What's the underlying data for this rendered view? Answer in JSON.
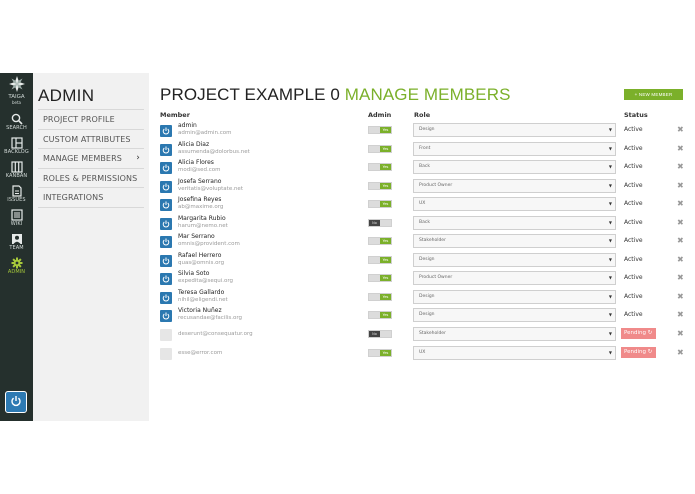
{
  "nav": {
    "logo_text": "TAIGA",
    "logo_sub": "beta",
    "items": [
      {
        "label": "SEARCH",
        "icon": "search-icon"
      },
      {
        "label": "BACKLOG",
        "icon": "backlog-icon"
      },
      {
        "label": "KANBAN",
        "icon": "kanban-icon"
      },
      {
        "label": "ISSUES",
        "icon": "issues-icon"
      },
      {
        "label": "WIKI",
        "icon": "wiki-icon"
      },
      {
        "label": "TEAM",
        "icon": "team-icon"
      },
      {
        "label": "ADMIN",
        "icon": "gear-icon"
      }
    ],
    "active_color": "#a7c93b"
  },
  "sidebar": {
    "title": "ADMIN",
    "items": [
      {
        "label": "PROJECT PROFILE"
      },
      {
        "label": "CUSTOM ATTRIBUTES"
      },
      {
        "label": "MANAGE MEMBERS",
        "chevron": "›"
      },
      {
        "label": "ROLES & PERMISSIONS"
      },
      {
        "label": "INTEGRATIONS"
      }
    ]
  },
  "header": {
    "project": "PROJECT EXAMPLE 0",
    "section": "MANAGE MEMBERS",
    "new_member_label": "+ NEW MEMBER",
    "accent": "#7bb02a"
  },
  "table": {
    "headers": {
      "member": "Member",
      "admin": "Admin",
      "role": "Role",
      "status": "Status"
    },
    "delete_glyph": "✖",
    "select_arrow": "▼",
    "rows": [
      {
        "name": "admin",
        "email": "admin@admin.com",
        "admin": "Yes",
        "role": "Design",
        "status": "Active"
      },
      {
        "name": "Alicia Diaz",
        "email": "assumenda@dolorbus.net",
        "admin": "Yes",
        "role": "Front",
        "status": "Active"
      },
      {
        "name": "Alicia Flores",
        "email": "modi@sed.com",
        "admin": "Yes",
        "role": "Back",
        "status": "Active"
      },
      {
        "name": "Josefa Serrano",
        "email": "veritatis@voluptate.net",
        "admin": "Yes",
        "role": "Product Owner",
        "status": "Active"
      },
      {
        "name": "Josefina Reyes",
        "email": "ab@maxime.org",
        "admin": "Yes",
        "role": "UX",
        "status": "Active"
      },
      {
        "name": "Margarita Rubio",
        "email": "harum@nemo.net",
        "admin": "No",
        "role": "Back",
        "status": "Active"
      },
      {
        "name": "Mar Serrano",
        "email": "omnis@provident.com",
        "admin": "Yes",
        "role": "Stakeholder",
        "status": "Active"
      },
      {
        "name": "Rafael Herrero",
        "email": "quas@omnis.org",
        "admin": "Yes",
        "role": "Design",
        "status": "Active"
      },
      {
        "name": "Silvia Soto",
        "email": "expedita@sequi.org",
        "admin": "Yes",
        "role": "Product Owner",
        "status": "Active"
      },
      {
        "name": "Teresa Gallardo",
        "email": "nihil@eligendi.net",
        "admin": "Yes",
        "role": "Design",
        "status": "Active"
      },
      {
        "name": "Victoria Nuñez",
        "email": "recusandae@facilis.org",
        "admin": "Yes",
        "role": "Design",
        "status": "Active"
      },
      {
        "name": "",
        "email": "deserunt@consequatur.org",
        "admin": "No",
        "role": "Stakeholder",
        "status": "Pending",
        "status_icon": "↻"
      },
      {
        "name": "",
        "email": "esse@error.com",
        "admin": "Yes",
        "role": "UX",
        "status": "Pending",
        "status_icon": "↻"
      }
    ]
  }
}
